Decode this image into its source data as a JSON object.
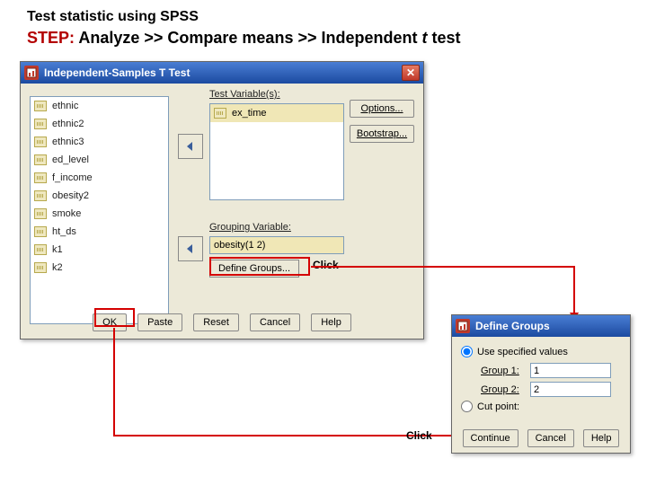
{
  "slide": {
    "title": "Test statistic using SPSS",
    "step_prefix": "STEP:  ",
    "step_text": "Analyze >> Compare means >> Independent ",
    "step_em": "t",
    "step_tail": " test"
  },
  "anno": {
    "click1": "Click",
    "click2": "Click"
  },
  "dialog": {
    "title": "Independent-Samples T Test",
    "testvar_label": "Test Variable(s):",
    "groupvar_label": "Grouping Variable:",
    "testvar_items": [
      "ex_time"
    ],
    "groupvar_value": "obesity(1 2)",
    "vars": [
      "ethnic",
      "ethnic2",
      "ethnic3",
      "ed_level",
      "f_income",
      "obesity2",
      "smoke",
      "ht_ds",
      "k1",
      "k2"
    ],
    "buttons": {
      "options": "Options...",
      "bootstrap": "Bootstrap...",
      "define_groups": "Define Groups...",
      "ok": "OK",
      "paste": "Paste",
      "reset": "Reset",
      "cancel": "Cancel",
      "help": "Help"
    }
  },
  "define_groups": {
    "title": "Define Groups",
    "use_specified": "Use specified values",
    "group1_label": "Group 1:",
    "group2_label": "Group 2:",
    "group1_value": "1",
    "group2_value": "2",
    "cutpoint": "Cut point:",
    "continue": "Continue",
    "cancel": "Cancel",
    "help": "Help"
  }
}
